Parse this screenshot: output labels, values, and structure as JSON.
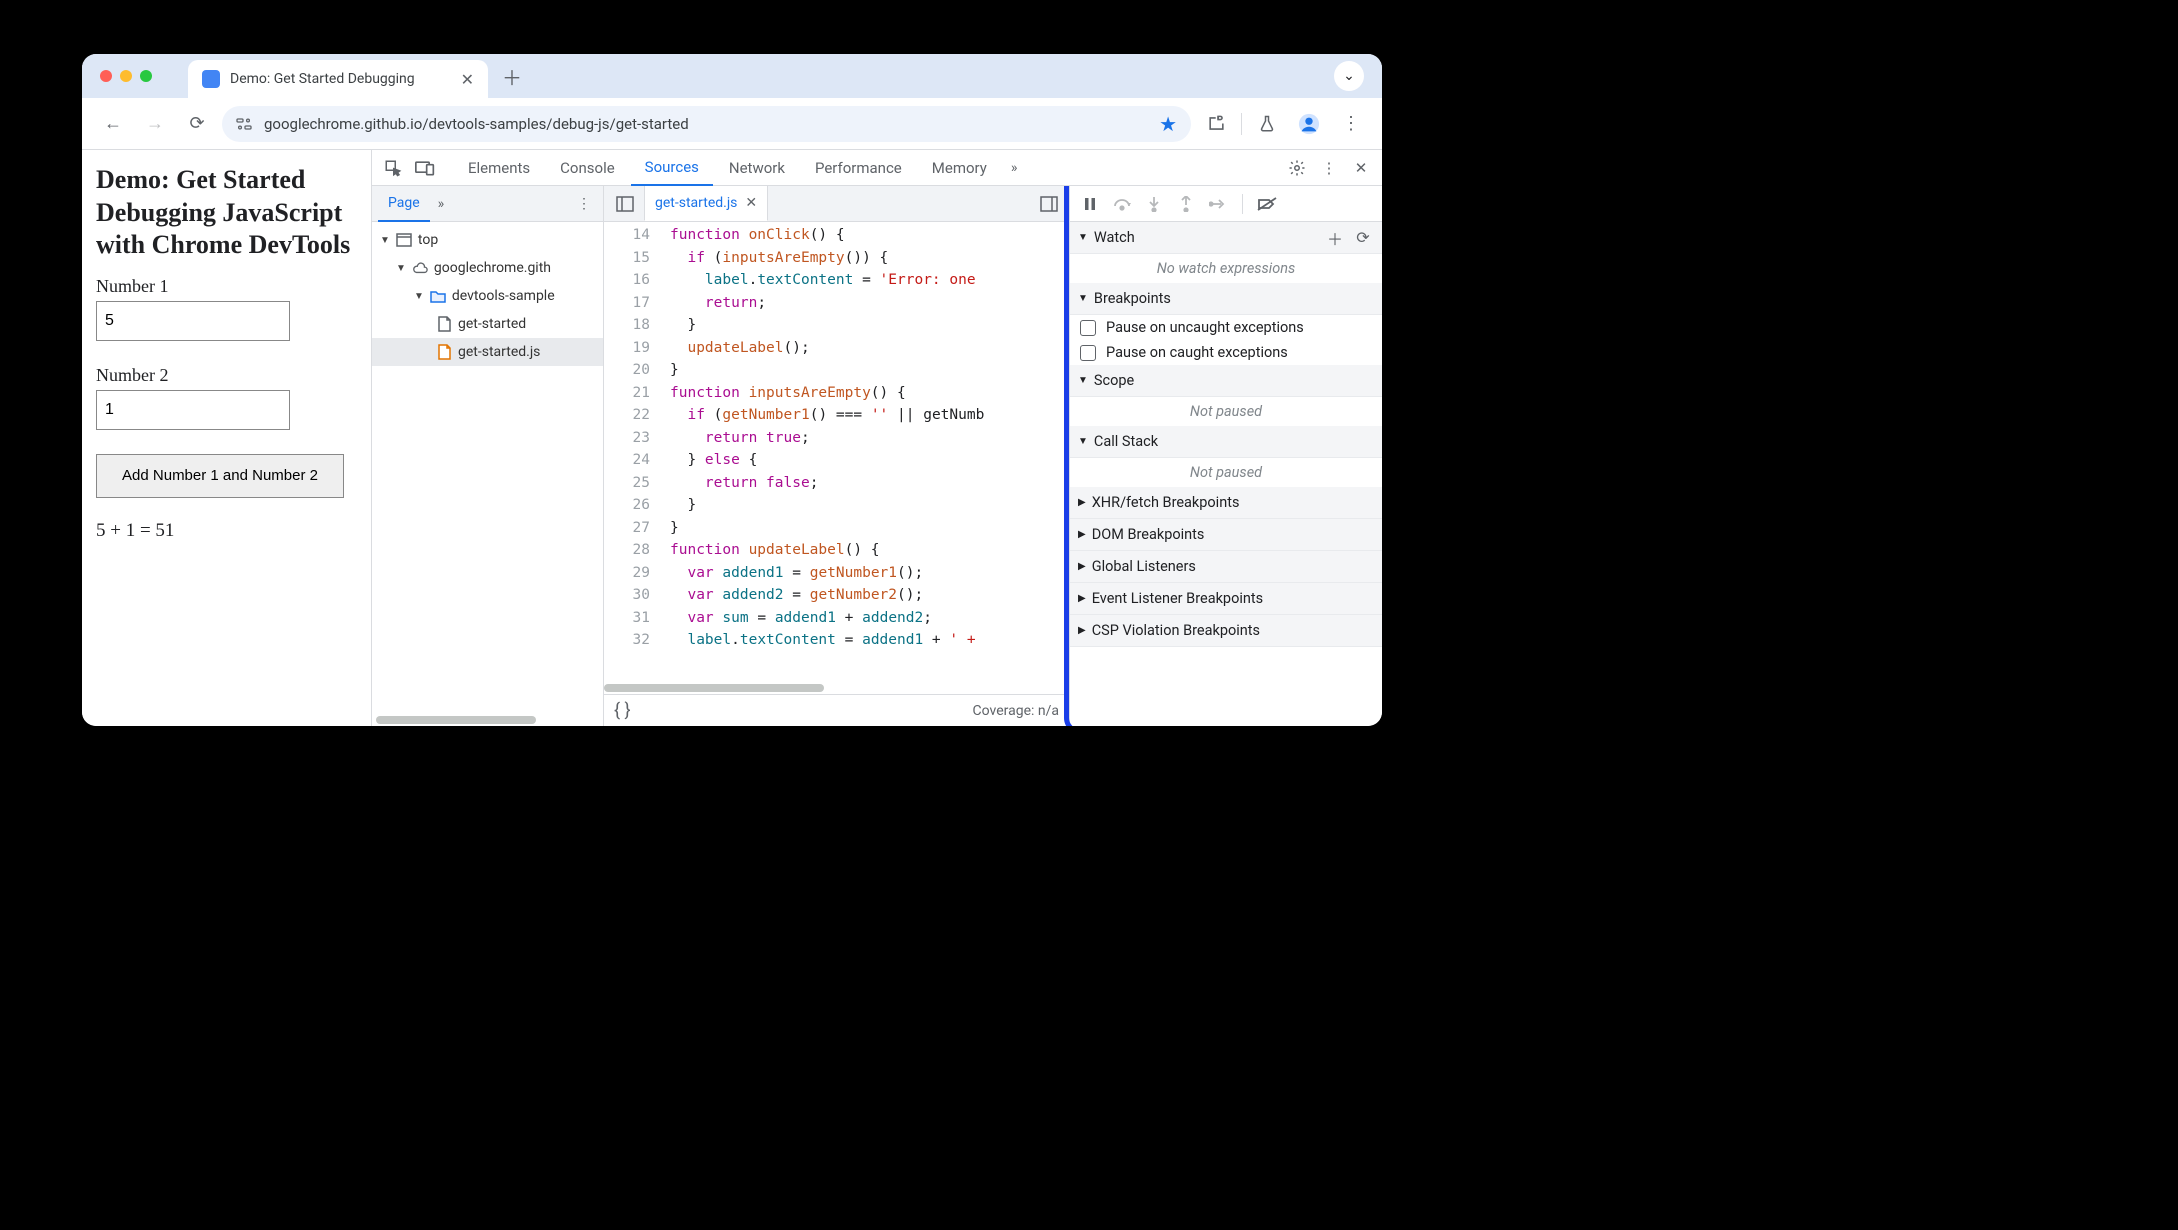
{
  "browser": {
    "tab_title": "Demo: Get Started Debugging",
    "url": "googlechrome.github.io/devtools-samples/debug-js/get-started"
  },
  "page": {
    "heading": "Demo: Get Started Debugging JavaScript with Chrome DevTools",
    "label1": "Number 1",
    "value1": "5",
    "label2": "Number 2",
    "value2": "1",
    "button": "Add Number 1 and Number 2",
    "result": "5 + 1 = 51"
  },
  "devtools": {
    "tabs": [
      "Elements",
      "Console",
      "Sources",
      "Network",
      "Performance",
      "Memory"
    ],
    "active_tab": "Sources",
    "left": {
      "page_tab": "Page",
      "tree": {
        "root": "top",
        "domain": "googlechrome.gith",
        "folder": "devtools-sample",
        "files": [
          "get-started",
          "get-started.js"
        ],
        "selected": "get-started.js"
      }
    },
    "editor": {
      "filename": "get-started.js",
      "first_line": 14,
      "lines": [
        "function onClick() {",
        "  if (inputsAreEmpty()) {",
        "    label.textContent = 'Error: one",
        "    return;",
        "  }",
        "  updateLabel();",
        "}",
        "function inputsAreEmpty() {",
        "  if (getNumber1() === '' || getNumb",
        "    return true;",
        "  } else {",
        "    return false;",
        "  }",
        "}",
        "function updateLabel() {",
        "  var addend1 = getNumber1();",
        "  var addend2 = getNumber2();",
        "  var sum = addend1 + addend2;",
        "  label.textContent = addend1 + ' +"
      ],
      "coverage": "Coverage: n/a"
    },
    "right": {
      "watch": {
        "title": "Watch",
        "empty": "No watch expressions"
      },
      "breakpoints": {
        "title": "Breakpoints",
        "uncaught": "Pause on uncaught exceptions",
        "caught": "Pause on caught exceptions"
      },
      "scope": {
        "title": "Scope",
        "empty": "Not paused"
      },
      "callstack": {
        "title": "Call Stack",
        "empty": "Not paused"
      },
      "collapsed": [
        "XHR/fetch Breakpoints",
        "DOM Breakpoints",
        "Global Listeners",
        "Event Listener Breakpoints",
        "CSP Violation Breakpoints"
      ]
    }
  }
}
